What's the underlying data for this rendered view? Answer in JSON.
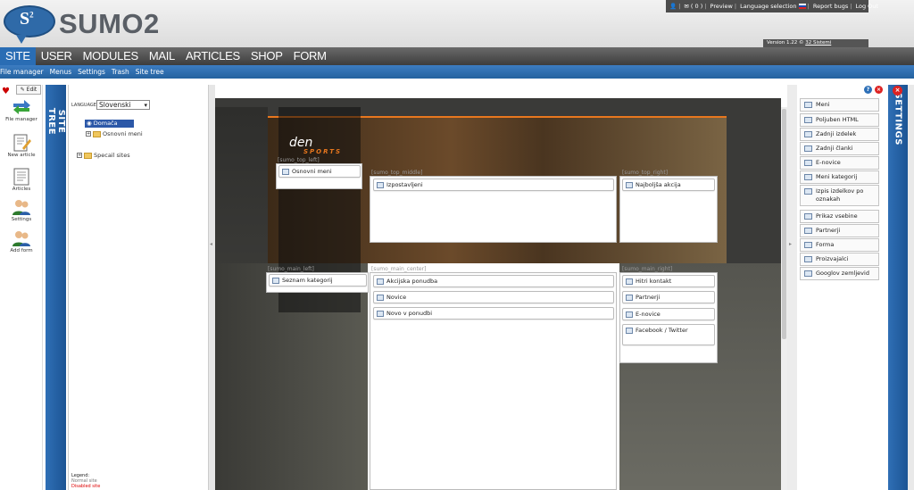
{
  "app": {
    "logo_text": "SUMO2",
    "logo_badge": "S",
    "logo_badge_sup": "2"
  },
  "topbar": {
    "cart_count": "( 0 )",
    "preview": "Preview",
    "language_selection": "Language selection",
    "report_bugs": "Report bugs",
    "logout": "Log Out"
  },
  "version": {
    "prefix": "Version 1.22 © ",
    "link": "32 Sistemi"
  },
  "main_nav": [
    {
      "label": "SITE",
      "active": true
    },
    {
      "label": "USER"
    },
    {
      "label": "MODULES"
    },
    {
      "label": "MAIL"
    },
    {
      "label": "ARTICLES"
    },
    {
      "label": "SHOP"
    },
    {
      "label": "FORM"
    }
  ],
  "sub_nav": [
    "File manager",
    "Menus",
    "Settings",
    "Trash",
    "Site tree"
  ],
  "tools": {
    "edit": "Edit",
    "items": [
      "File manager",
      "New article",
      "Articles",
      "Settings",
      "Add form"
    ]
  },
  "site_tree": {
    "title": "SITE TREE",
    "language_label": "LANGUAGE",
    "language_value": "Slovenski",
    "nodes": {
      "home": "Domača stran",
      "meni": "Osnovni meni",
      "special": "Specail sites"
    },
    "legend": {
      "title": "Legend:",
      "normal": "Normal site",
      "disabled": "Disabled site"
    }
  },
  "zones": {
    "top_left": "[sumo_top_left]",
    "top_middle": "[sumo_top_middle]",
    "top_right": "[sumo_top_right]",
    "main_left": "[sumo_main_left]",
    "main_center": "[sumo_main_center]",
    "main_right": "[sumo_main_right]"
  },
  "preview_logo": {
    "line1": "den",
    "line2": "SPORTS"
  },
  "modules": {
    "top_left": [
      "Osnovni meni"
    ],
    "top_middle": [
      "Izpostavljeni"
    ],
    "top_right": [
      "Najboljša akcija"
    ],
    "main_left": [
      "Seznam kategorij"
    ],
    "main_center": [
      "Akcijska ponudba",
      "Novice",
      "Novo v ponudbi"
    ],
    "main_right": [
      "Hitri kontakt",
      "Partnerji",
      "E-novice",
      "Facebook / Twitter"
    ]
  },
  "settings": {
    "title": "SETTINGS",
    "modules": [
      "Meni",
      "Poljuben HTML",
      "Zadnji izdelek",
      "Zadnji članki",
      "E-novice",
      "Meni kategorij",
      "Izpis izdelkov po oznakah",
      "Prikaz vsebine",
      "Partnerji",
      "Forma",
      "Proizvajalci",
      "Googlov zemljevid"
    ]
  },
  "colors": {
    "accent_blue": "#2a6db4",
    "nav_dark": "#4a4a4a",
    "orange": "#e8771e",
    "close_red": "#dd2222"
  }
}
